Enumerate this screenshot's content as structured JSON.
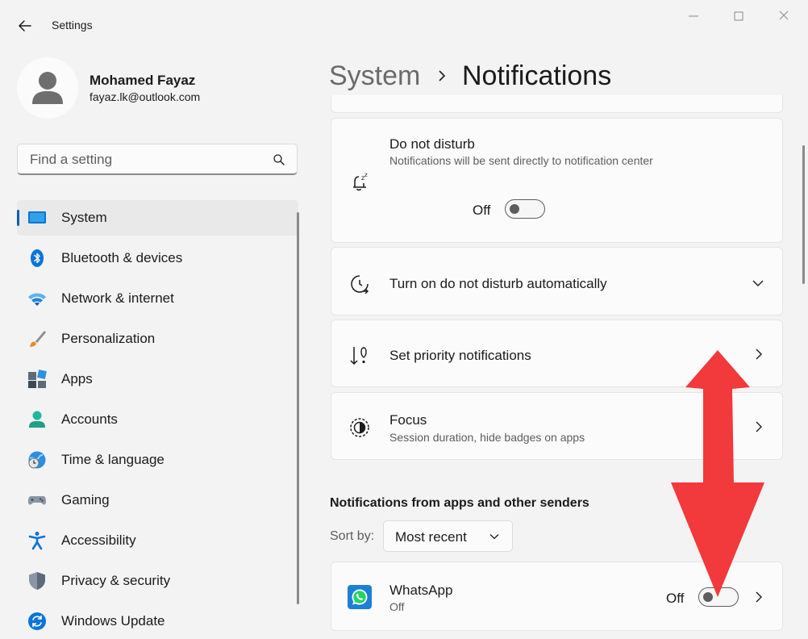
{
  "window": {
    "title": "Settings",
    "minimize_glyph": "—",
    "maximize_glyph": "☐",
    "close_glyph": "✕"
  },
  "user": {
    "name": "Mohamed Fayaz",
    "email": "fayaz.lk@outlook.com"
  },
  "search": {
    "placeholder": "Find a setting",
    "icon": "search-icon"
  },
  "sidebar": {
    "items": [
      {
        "label": "System",
        "icon": "system-display-icon",
        "active": true
      },
      {
        "label": "Bluetooth & devices",
        "icon": "bluetooth-icon"
      },
      {
        "label": "Network & internet",
        "icon": "wifi-icon"
      },
      {
        "label": "Personalization",
        "icon": "paintbrush-icon"
      },
      {
        "label": "Apps",
        "icon": "apps-icon"
      },
      {
        "label": "Accounts",
        "icon": "accounts-icon"
      },
      {
        "label": "Time & language",
        "icon": "time-language-icon"
      },
      {
        "label": "Gaming",
        "icon": "gamepad-icon"
      },
      {
        "label": "Accessibility",
        "icon": "accessibility-icon"
      },
      {
        "label": "Privacy & security",
        "icon": "shield-icon"
      },
      {
        "label": "Windows Update",
        "icon": "update-icon"
      }
    ]
  },
  "breadcrumb": {
    "parent": "System",
    "current": "Notifications"
  },
  "cards": {
    "dnd": {
      "title": "Do not disturb",
      "subtitle": "Notifications will be sent directly to notification center",
      "state_label": "Off",
      "on": false
    },
    "auto_dnd": {
      "title": "Turn on do not disturb automatically"
    },
    "priority": {
      "title": "Set priority notifications"
    },
    "focus": {
      "title": "Focus",
      "subtitle": "Session duration, hide badges on apps"
    }
  },
  "apps_section": {
    "heading": "Notifications from apps and other senders",
    "sort_label": "Sort by:",
    "sort_value": "Most recent",
    "apps": [
      {
        "name": "WhatsApp",
        "status": "Off",
        "toggle_label": "Off",
        "on": false
      }
    ]
  },
  "colors": {
    "accent": "#005fb8",
    "annotation_arrow": "#f2393c",
    "whatsapp": "#25d366"
  }
}
